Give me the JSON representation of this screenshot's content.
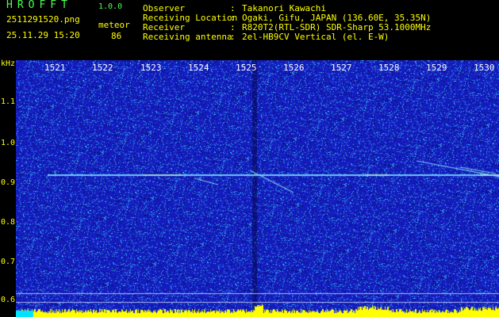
{
  "app": {
    "name": "HROFFT",
    "version": "1.0.0"
  },
  "file": {
    "name": "2511291520.png",
    "datetime": "25.11.29 15:20"
  },
  "meteor": {
    "label": "meteor",
    "count": "86"
  },
  "info": [
    {
      "label": "Observer",
      "value": "Takanori Kawachi"
    },
    {
      "label": "Receiving Location",
      "value": "Ogaki, Gifu, JAPAN (136.60E, 35.35N)"
    },
    {
      "label": "Receiver",
      "value": "R820T2(RTL-SDR) SDR-Sharp 53.1000MHz"
    },
    {
      "label": "Receiving antenna",
      "value": "2el-HB9CV Vertical (el. E-W)"
    }
  ],
  "colors": {
    "green": "#4cff4c",
    "yellow": "#ffff00",
    "background_blue": "#1a1cb0"
  },
  "chart_data": {
    "type": "heatmap",
    "ylabel": "kHz",
    "x_ticks": [
      "1521",
      "1522",
      "1523",
      "1524",
      "1525",
      "1526",
      "1527",
      "1528",
      "1529",
      "1530"
    ],
    "y_ticks": [
      "1.1",
      "1.0",
      "0.9",
      "0.8",
      "0.7",
      "0.6"
    ],
    "ylim": [
      0.58,
      1.2
    ],
    "carrier_khz": 0.92
  }
}
